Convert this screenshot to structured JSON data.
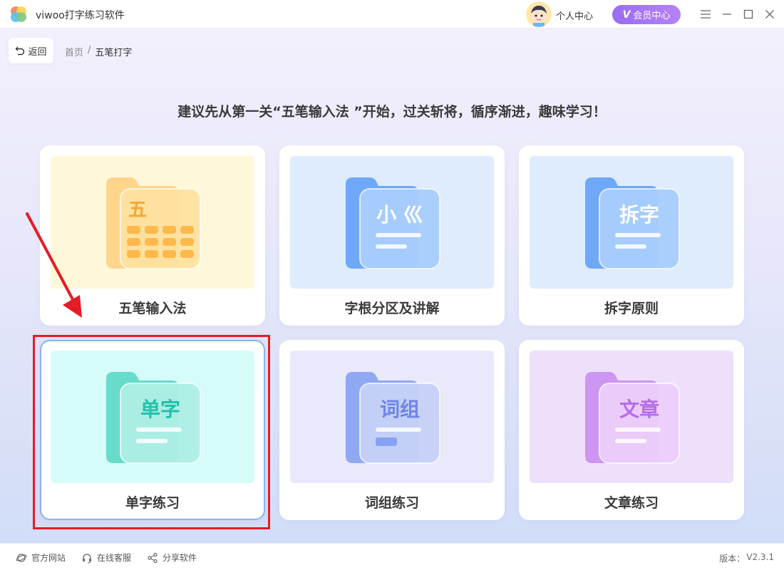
{
  "app": {
    "title": "viwoo打字练习软件"
  },
  "header": {
    "user_center": "个人中心",
    "vip_mark": "V",
    "vip_label": "会员中心",
    "window_controls": [
      "menu-icon",
      "minimize-icon",
      "maximize-icon",
      "close-icon"
    ]
  },
  "nav": {
    "back_label": "返回",
    "breadcrumb": {
      "home": "首页",
      "separator": "/",
      "current": "五笔打字"
    }
  },
  "heading": "建议先从第一关“五笔输入法 ”开始，过关斩将，循序渐进，趣味学习！",
  "cards": [
    {
      "label": "五笔输入法",
      "folder_text": "五",
      "icon": "keyboard-folder-icon",
      "colors": {
        "bg": "#fff7d9",
        "back": "#ffcf7d",
        "front": "#ffe2a0",
        "text": "#f3a632"
      }
    },
    {
      "label": "字根分区及讲解",
      "folder_text": "小 巛",
      "icon": "radicals-folder-icon",
      "colors": {
        "bg": "#deecfd",
        "back": "#5c9cf7",
        "front": "#a8cdfc",
        "text": "#ffffff"
      }
    },
    {
      "label": "拆字原则",
      "folder_text": "拆字",
      "icon": "split-char-folder-icon",
      "colors": {
        "bg": "#deecfd",
        "back": "#5c9cf7",
        "front": "#a8cdfc",
        "text": "#ffffff"
      }
    },
    {
      "label": "单字练习",
      "folder_text": "单字",
      "icon": "single-char-folder-icon",
      "active": true,
      "colors": {
        "bg": "#d6fcf9",
        "back": "#54d6c3",
        "front": "#aeeee4",
        "text": "#22c1ad"
      }
    },
    {
      "label": "词组练习",
      "folder_text": "词组",
      "icon": "phrase-folder-icon",
      "colors": {
        "bg": "#e9e9fb",
        "back": "#7f9cf1",
        "front": "#c6d1f7",
        "text": "#6f86e6"
      }
    },
    {
      "label": "文章练习",
      "folder_text": "文章",
      "icon": "article-folder-icon",
      "colors": {
        "bg": "#eedffb",
        "back": "#c58af0",
        "front": "#ebcdfa",
        "text": "#b56de6"
      }
    }
  ],
  "annotation": {
    "highlight_color": "#e51c23"
  },
  "footer": {
    "official_site": "官方网站",
    "online_service": "在线客服",
    "share_software": "分享软件",
    "version_label": "版本：",
    "version": "V2.3.1"
  }
}
